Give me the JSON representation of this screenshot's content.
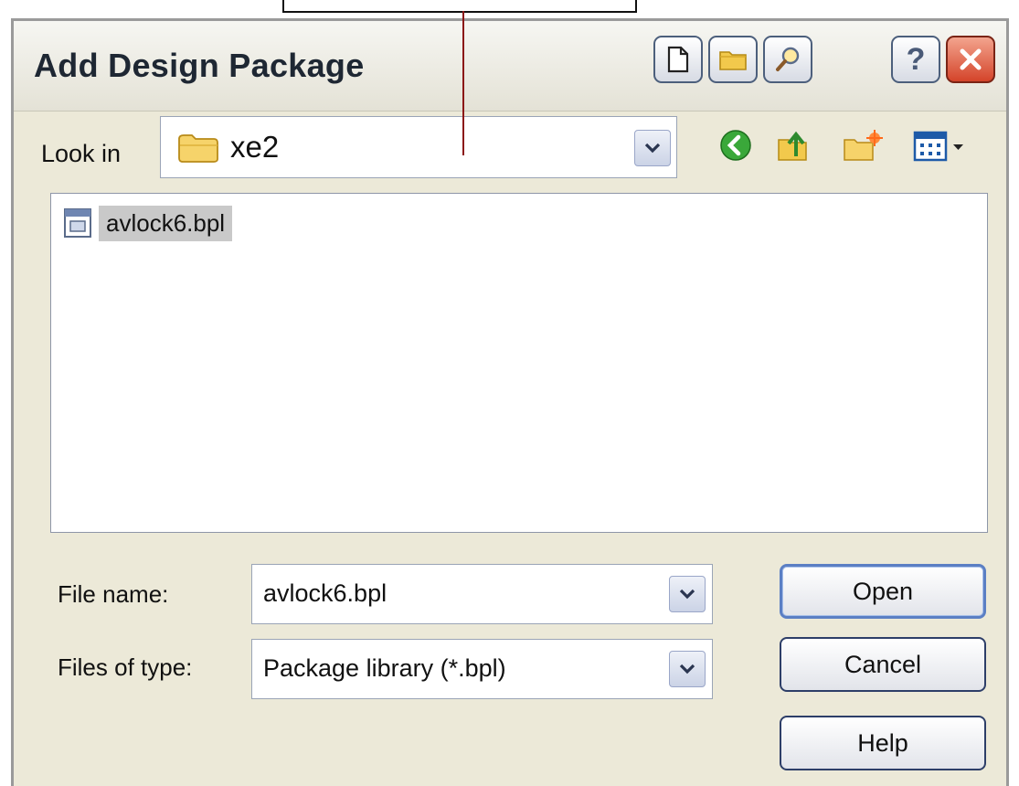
{
  "dialog": {
    "title": "Add Design Package"
  },
  "look_in": {
    "label": "Look in",
    "value": "xe2"
  },
  "files": [
    {
      "name": "avlock6.bpl"
    }
  ],
  "file_name": {
    "label": "File name:",
    "value": "avlock6.bpl"
  },
  "file_type": {
    "label": "Files of type:",
    "value": "Package library  (*.bpl)"
  },
  "buttons": {
    "open": "Open",
    "cancel": "Cancel",
    "help": "Help"
  },
  "title_help_glyph": "?",
  "icons": {
    "title_bar": [
      "new-file-icon",
      "folder-icon",
      "search-icon",
      "help-icon",
      "close-icon"
    ],
    "nav": [
      "back-icon",
      "up-folder-icon",
      "new-folder-icon",
      "view-menu-icon"
    ]
  }
}
